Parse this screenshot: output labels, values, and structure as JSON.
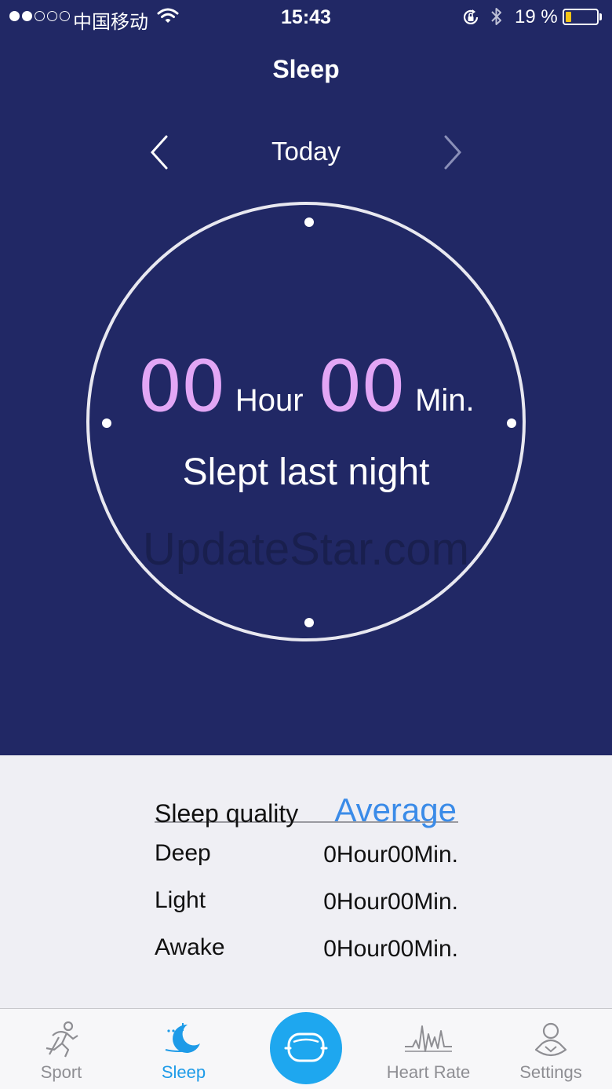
{
  "status_bar": {
    "carrier": "中国移动",
    "time": "15:43",
    "battery_percent": "19 %",
    "battery_level": 0.19,
    "signal_bars_filled": 2,
    "signal_bars_total": 5
  },
  "header": {
    "title": "Sleep"
  },
  "date_nav": {
    "label": "Today"
  },
  "summary": {
    "hours": "00",
    "hour_unit": "Hour",
    "minutes": "00",
    "minute_unit": "Min.",
    "caption": "Slept last night"
  },
  "watermark": "UpdateStar.com",
  "quality": {
    "label": "Sleep quality",
    "value": "Average",
    "rows": [
      {
        "name": "Deep",
        "value": "0Hour00Min."
      },
      {
        "name": "Light",
        "value": "0Hour00Min."
      },
      {
        "name": "Awake",
        "value": "0Hour00Min."
      }
    ]
  },
  "tabs": [
    {
      "label": "Sport",
      "icon": "runner-icon",
      "active": false
    },
    {
      "label": "Sleep",
      "icon": "moon-icon",
      "active": true
    },
    {
      "label": "Heart Rate",
      "icon": "heart-rate-icon",
      "active": false
    },
    {
      "label": "Settings",
      "icon": "settings-icon",
      "active": false
    }
  ],
  "colors": {
    "background_top": "#212865",
    "accent_digits": "#e2a6f5",
    "quality_value": "#3a8be8",
    "tab_active": "#1e9be8",
    "center_button": "#1ea7ef"
  }
}
